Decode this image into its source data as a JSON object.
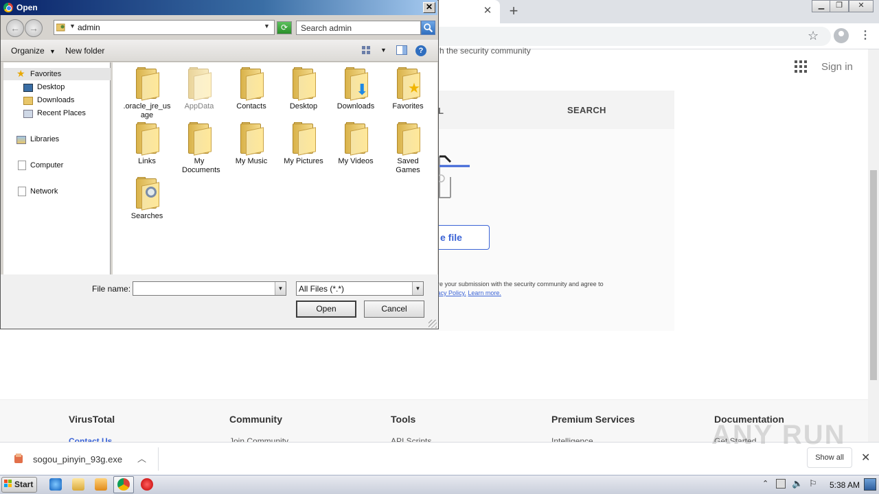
{
  "browser": {
    "partial_text": "h the security community",
    "sign_in": "Sign in",
    "tabs": {
      "file_partial": "L",
      "search": "SEARCH"
    },
    "choose_file_partial": "e file",
    "terms_line1": "are your submission with the security community and agree to",
    "terms_line2_prefix": "vacy Policy.",
    "terms_learn_more": "Learn more.",
    "footer": {
      "columns": [
        "VirusTotal",
        "Community",
        "Tools",
        "Premium Services",
        "Documentation"
      ],
      "links": [
        "Contact Us",
        "Join Community",
        "API Scripts",
        "Intelligence",
        "Get Started"
      ]
    },
    "download": {
      "filename": "sogou_pinyin_93g.exe",
      "show_all": "Show all"
    },
    "watermark": "ANY RUN"
  },
  "taskbar": {
    "start": "Start",
    "clock": "5:38 AM"
  },
  "dialog": {
    "title": "Open",
    "address": "admin",
    "search_placeholder": "Search admin",
    "toolbar": {
      "organize": "Organize",
      "new_folder": "New folder"
    },
    "nav": {
      "favorites": "Favorites",
      "desktop": "Desktop",
      "downloads": "Downloads",
      "recent_places": "Recent Places",
      "libraries": "Libraries",
      "computer": "Computer",
      "network": "Network"
    },
    "folders": [
      ".oracle_jre_usage",
      "AppData",
      "Contacts",
      "Desktop",
      "Downloads",
      "Favorites",
      "Links",
      "My Documents",
      "My Music",
      "My Pictures",
      "My Videos",
      "Saved Games",
      "Searches"
    ],
    "file_name_label": "File name:",
    "file_name_value": "",
    "file_type": "All Files (*.*)",
    "open_button": "Open",
    "cancel_button": "Cancel"
  }
}
